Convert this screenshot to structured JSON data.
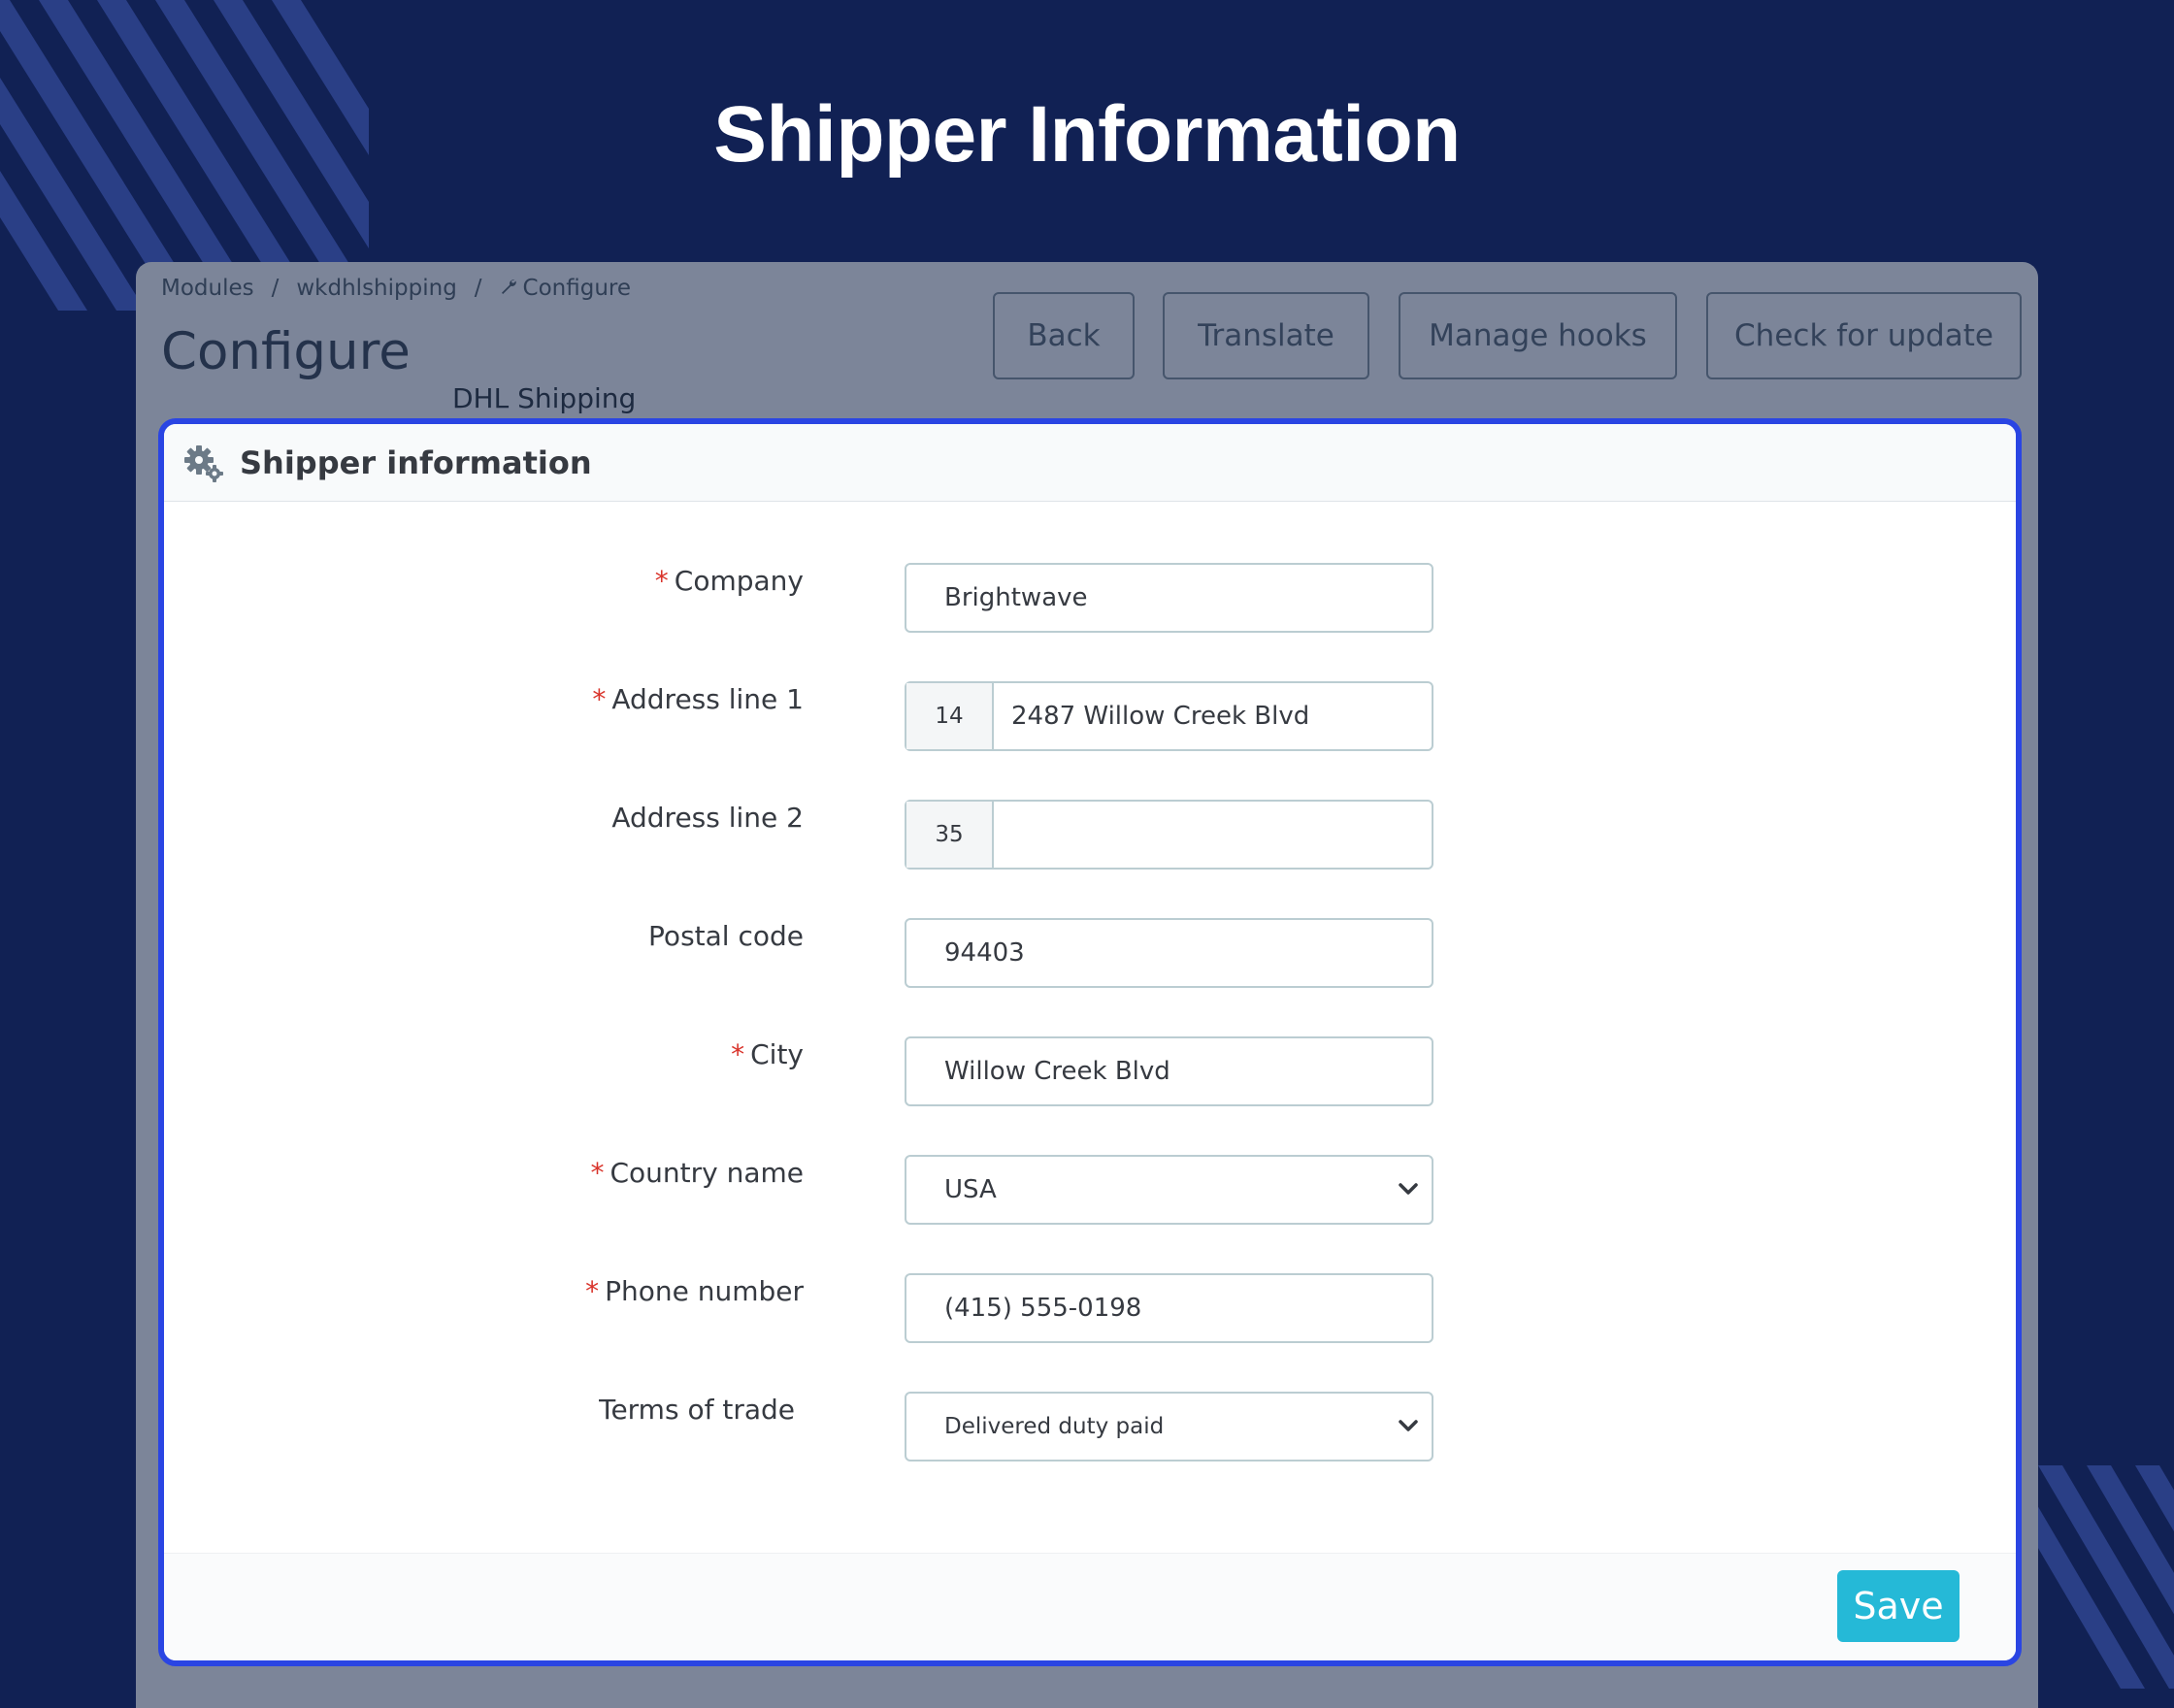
{
  "hero": {
    "title": "Shipper Information"
  },
  "breadcrumb": {
    "items": [
      "Modules",
      "wkdhlshipping",
      "Configure"
    ],
    "separator": "/"
  },
  "header": {
    "title": "Configure",
    "subtitle": "DHL Shipping"
  },
  "toolbar": {
    "back": "Back",
    "translate": "Translate",
    "manage_hooks": "Manage hooks",
    "check_update": "Check for update"
  },
  "card": {
    "title": "Shipper information"
  },
  "form": {
    "required_marker": "*",
    "company": {
      "label": "Company",
      "value": "Brightwave"
    },
    "address1": {
      "label": "Address line 1",
      "counter": "14",
      "value": "2487 Willow Creek Blvd"
    },
    "address2": {
      "label": "Address line 2",
      "counter": "35",
      "value": ""
    },
    "postal_code": {
      "label": "Postal code",
      "value": "94403"
    },
    "city": {
      "label": "City",
      "value": "Willow Creek Blvd"
    },
    "country": {
      "label": "Country name",
      "value": "USA"
    },
    "phone": {
      "label": "Phone number",
      "value": "(415) 555-0198"
    },
    "terms": {
      "label": "Terms of trade",
      "value": "Delivered duty paid"
    }
  },
  "footer": {
    "save": "Save"
  },
  "colors": {
    "background": "#112154",
    "panel": "#7c8599",
    "highlight_border": "#2a45e3",
    "save_button": "#25b9d7",
    "required": "#d9342b"
  },
  "icons": {
    "header": "gears-icon",
    "breadcrumb": "wrench-icon",
    "select": "chevron-down-icon"
  }
}
